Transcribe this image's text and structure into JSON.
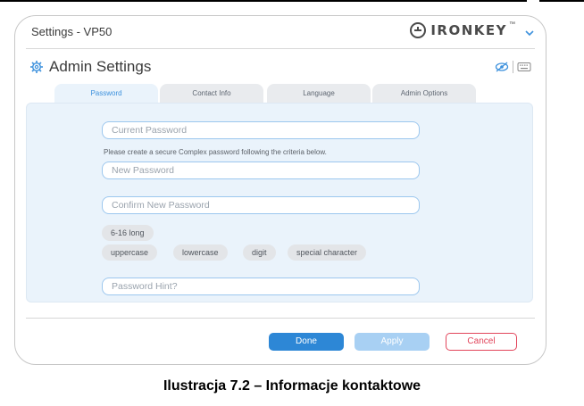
{
  "window": {
    "title": "Settings - VP50",
    "brand": "IRONKEY",
    "brand_mark": "™"
  },
  "section": {
    "title": "Admin Settings"
  },
  "tabs": [
    {
      "label": "Password",
      "active": true
    },
    {
      "label": "Contact Info",
      "active": false
    },
    {
      "label": "Language",
      "active": false
    },
    {
      "label": "Admin Options",
      "active": false
    }
  ],
  "form": {
    "current_password_placeholder": "Current Password",
    "helper_text": "Please create a secure Complex password following the criteria below.",
    "new_password_placeholder": "New Password",
    "confirm_password_placeholder": "Confirm New Password",
    "hint_placeholder": "Password Hint?",
    "criteria": {
      "length": "6-16 long",
      "uppercase": "uppercase",
      "lowercase": "lowercase",
      "digit": "digit",
      "special": "special character"
    }
  },
  "buttons": {
    "done": "Done",
    "apply": "Apply",
    "cancel": "Cancel"
  },
  "caption": "Ilustracja 7.2 – Informacje kontaktowe",
  "colors": {
    "accent": "#2d87d6",
    "accent_light": "#a8d0f3",
    "danger": "#e2455b",
    "panel_bg": "#eaf3fb",
    "field_border": "#9cc7ee"
  },
  "icons": [
    "ironkey-logo-icon",
    "chevron-down-icon",
    "gear-icon",
    "eye-hidden-icon",
    "keyboard-icon"
  ]
}
